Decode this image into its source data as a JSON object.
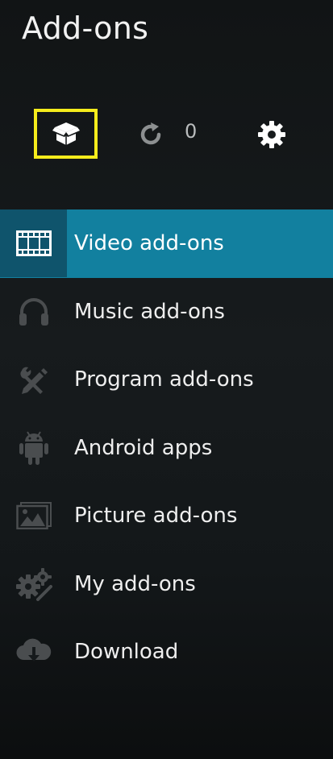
{
  "header": {
    "title": "Add-ons"
  },
  "toolbar": {
    "install_icon": "open-box-icon",
    "update_icon": "refresh-icon",
    "update_count": "0",
    "settings_icon": "gear-icon",
    "focus_color": "#f5ec1c"
  },
  "menu": {
    "accent_color": "#12809f",
    "items": [
      {
        "label": "Video add-ons",
        "icon": "film-strip-icon",
        "active": true
      },
      {
        "label": "Music add-ons",
        "icon": "headphones-icon",
        "active": false
      },
      {
        "label": "Program add-ons",
        "icon": "pencil-wrench-icon",
        "active": false
      },
      {
        "label": "Android apps",
        "icon": "android-icon",
        "active": false
      },
      {
        "label": "Picture add-ons",
        "icon": "picture-icon",
        "active": false
      },
      {
        "label": "My add-ons",
        "icon": "gears-icon",
        "active": false
      },
      {
        "label": "Download",
        "icon": "cloud-download-icon",
        "active": false
      }
    ]
  }
}
